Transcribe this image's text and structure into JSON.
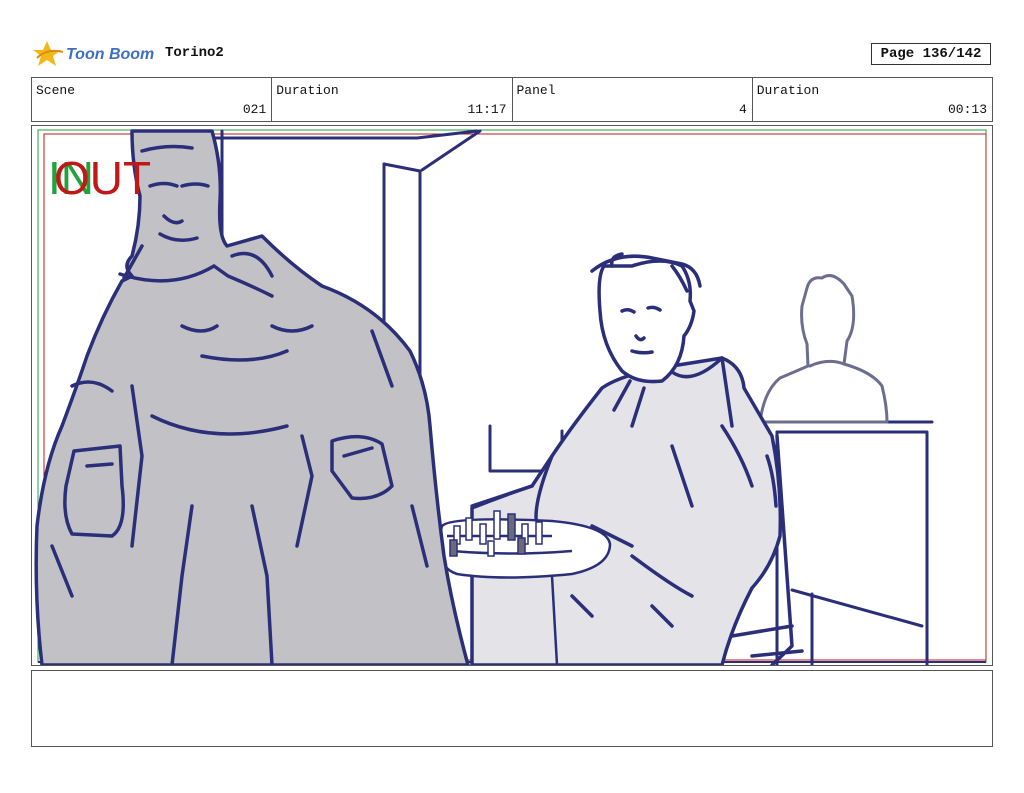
{
  "header": {
    "logo_text": "Toon Boom",
    "project": "Torino2",
    "page": "Page 136/142"
  },
  "info": [
    {
      "label": "Scene",
      "value": "021"
    },
    {
      "label": "Duration",
      "value": "11:17"
    },
    {
      "label": "Panel",
      "value": "4"
    },
    {
      "label": "Duration",
      "value": "00:13"
    }
  ],
  "panel": {
    "in_marker": "IN",
    "out_marker": "OUT"
  },
  "notes": {
    "text": ""
  },
  "colors": {
    "sketch_line": "#2b2f7a",
    "figure_fill": "#c2c2c6",
    "clothes_fill": "#e3e3e8",
    "in_green": "#1fa33a",
    "out_red": "#c01818",
    "logo_yellow": "#f2b81a",
    "logo_blue": "#3f6fc3"
  }
}
